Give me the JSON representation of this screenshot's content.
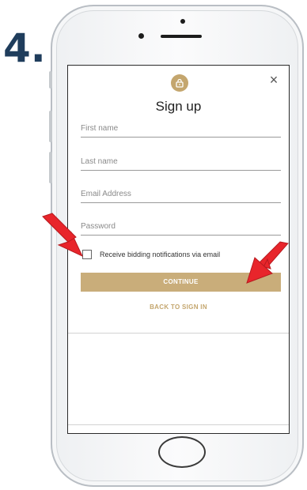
{
  "annotation": {
    "step_number": "4.",
    "arrow_color": "#e8252b"
  },
  "modal": {
    "lock_icon": "lock-icon",
    "close_icon": "close-icon",
    "close_label": "×",
    "title": "Sign up",
    "fields": [
      {
        "placeholder": "First name"
      },
      {
        "placeholder": "Last name"
      },
      {
        "placeholder": "Email Address"
      },
      {
        "placeholder": "Password"
      }
    ],
    "checkbox": {
      "label": "Receive bidding notifications via email",
      "checked": false
    },
    "continue_label": "CONTINUE",
    "back_label": "BACK TO SIGN IN"
  },
  "colors": {
    "accent": "#c9ad7a",
    "step_text": "#1f3d5c",
    "arrow": "#e8252b"
  }
}
